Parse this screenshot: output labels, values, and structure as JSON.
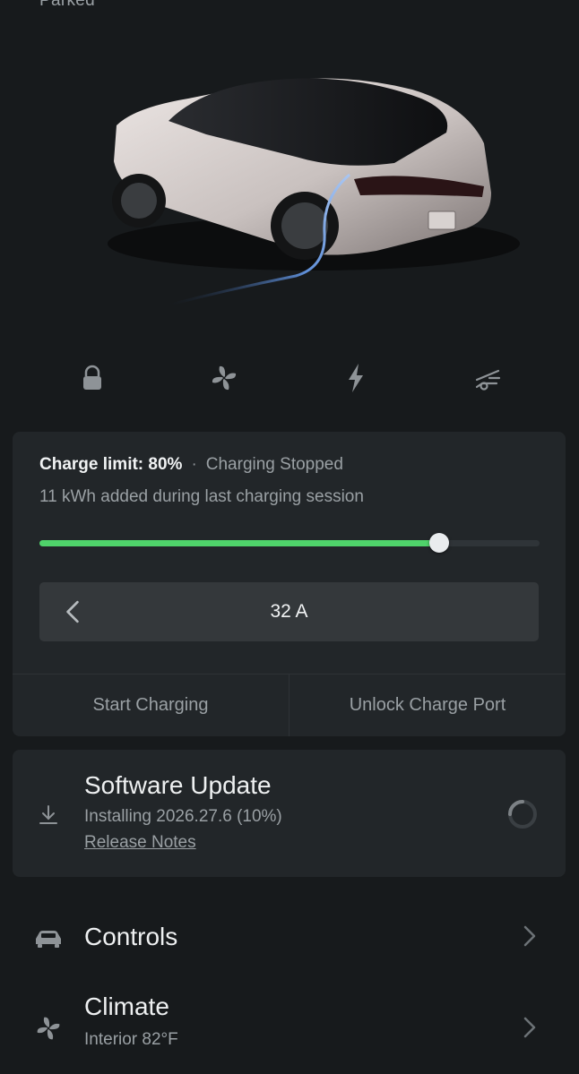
{
  "status": "Parked",
  "quick_actions": [
    {
      "name": "lock-icon"
    },
    {
      "name": "fan-icon"
    },
    {
      "name": "bolt-icon"
    },
    {
      "name": "car-openings-icon"
    }
  ],
  "charging": {
    "limit_label": "Charge limit: 80%",
    "separator": "·",
    "state": "Charging Stopped",
    "summary": "11 kWh added during last charging session",
    "limit_fraction": 0.8,
    "amps": "32 A",
    "start_label": "Start Charging",
    "unlock_label": "Unlock Charge Port",
    "accent": "#4fd36a"
  },
  "update": {
    "title": "Software Update",
    "status": "Installing 2026.27.6 (10%)",
    "link": "Release Notes"
  },
  "menu": [
    {
      "title": "Controls",
      "icon": "car-icon"
    },
    {
      "title": "Climate",
      "subtitle": "Interior 82°F",
      "icon": "fan-icon"
    }
  ]
}
